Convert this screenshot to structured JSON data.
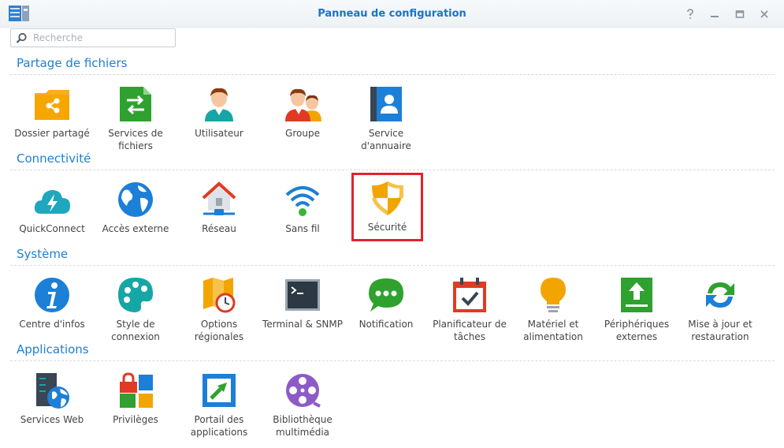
{
  "window": {
    "title": "Panneau de configuration",
    "help_icon": "help-icon",
    "minimize_icon": "minimize-icon",
    "maximize_icon": "maximize-icon",
    "close_icon": "close-icon"
  },
  "search": {
    "placeholder": "Recherche"
  },
  "colors": {
    "accent": "#1f7fd4",
    "title": "#1a73c9",
    "highlight": "#e0242e"
  },
  "sections": [
    {
      "title": "Partage de fichiers",
      "items": [
        {
          "label": "Dossier partagé",
          "icon": "shared-folder-icon"
        },
        {
          "label": "Services de fichiers",
          "icon": "file-services-icon"
        },
        {
          "label": "Utilisateur",
          "icon": "user-icon"
        },
        {
          "label": "Groupe",
          "icon": "group-icon"
        },
        {
          "label": "Service d'annuaire",
          "icon": "directory-service-icon"
        }
      ]
    },
    {
      "title": "Connectivité",
      "items": [
        {
          "label": "QuickConnect",
          "icon": "quickconnect-icon"
        },
        {
          "label": "Accès externe",
          "icon": "external-access-icon"
        },
        {
          "label": "Réseau",
          "icon": "network-icon"
        },
        {
          "label": "Sans fil",
          "icon": "wireless-icon"
        },
        {
          "label": "Sécurité",
          "icon": "security-icon",
          "selected": true
        }
      ]
    },
    {
      "title": "Système",
      "items": [
        {
          "label": "Centre d'infos",
          "icon": "info-center-icon"
        },
        {
          "label": "Style de connexion",
          "icon": "login-style-icon"
        },
        {
          "label": "Options régionales",
          "icon": "regional-options-icon"
        },
        {
          "label": "Terminal & SNMP",
          "icon": "terminal-icon"
        },
        {
          "label": "Notification",
          "icon": "notification-icon"
        },
        {
          "label": "Planificateur de tâches",
          "icon": "task-scheduler-icon"
        },
        {
          "label": "Matériel et alimentation",
          "icon": "hardware-power-icon"
        },
        {
          "label": "Périphériques externes",
          "icon": "external-devices-icon"
        },
        {
          "label": "Mise à jour et restauration",
          "icon": "update-restore-icon"
        }
      ]
    },
    {
      "title": "Applications",
      "items": [
        {
          "label": "Services Web",
          "icon": "web-services-icon"
        },
        {
          "label": "Privilèges",
          "icon": "privileges-icon"
        },
        {
          "label": "Portail des applications",
          "icon": "application-portal-icon"
        },
        {
          "label": "Bibliothèque multimédia",
          "icon": "media-library-icon"
        }
      ]
    }
  ]
}
